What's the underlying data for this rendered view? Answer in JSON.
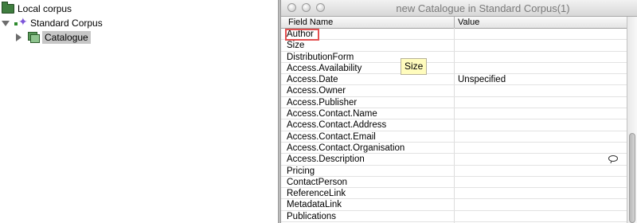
{
  "tree": {
    "root_label": "Local corpus",
    "corpus_label": "Standard Corpus",
    "catalogue_label": "Catalogue"
  },
  "window": {
    "title": "new Catalogue in Standard Corpus(1)"
  },
  "table": {
    "columns": [
      "Field Name",
      "Value"
    ],
    "rows": [
      {
        "name": "Author",
        "value": ""
      },
      {
        "name": "Size",
        "value": ""
      },
      {
        "name": "DistributionForm",
        "value": ""
      },
      {
        "name": "Access.Availability",
        "value": ""
      },
      {
        "name": "Access.Date",
        "value": "Unspecified"
      },
      {
        "name": "Access.Owner",
        "value": ""
      },
      {
        "name": "Access.Publisher",
        "value": ""
      },
      {
        "name": "Access.Contact.Name",
        "value": ""
      },
      {
        "name": "Access.Contact.Address",
        "value": ""
      },
      {
        "name": "Access.Contact.Email",
        "value": ""
      },
      {
        "name": "Access.Contact.Organisation",
        "value": ""
      },
      {
        "name": "Access.Description",
        "value": ""
      },
      {
        "name": "Pricing",
        "value": ""
      },
      {
        "name": "ContactPerson",
        "value": ""
      },
      {
        "name": "ReferenceLink",
        "value": ""
      },
      {
        "name": "MetadataLink",
        "value": ""
      },
      {
        "name": "Publications",
        "value": ""
      }
    ]
  },
  "tooltip": {
    "text": "Size"
  },
  "icons": {
    "folder": "folder-icon",
    "corpus": "corpus-icon",
    "catalogue": "catalogue-icon",
    "comment": "comment-bubble-icon"
  },
  "colors": {
    "highlight_border": "#e35050",
    "tooltip_bg": "#fffcbd",
    "selection_bg": "#c6c6c6"
  }
}
